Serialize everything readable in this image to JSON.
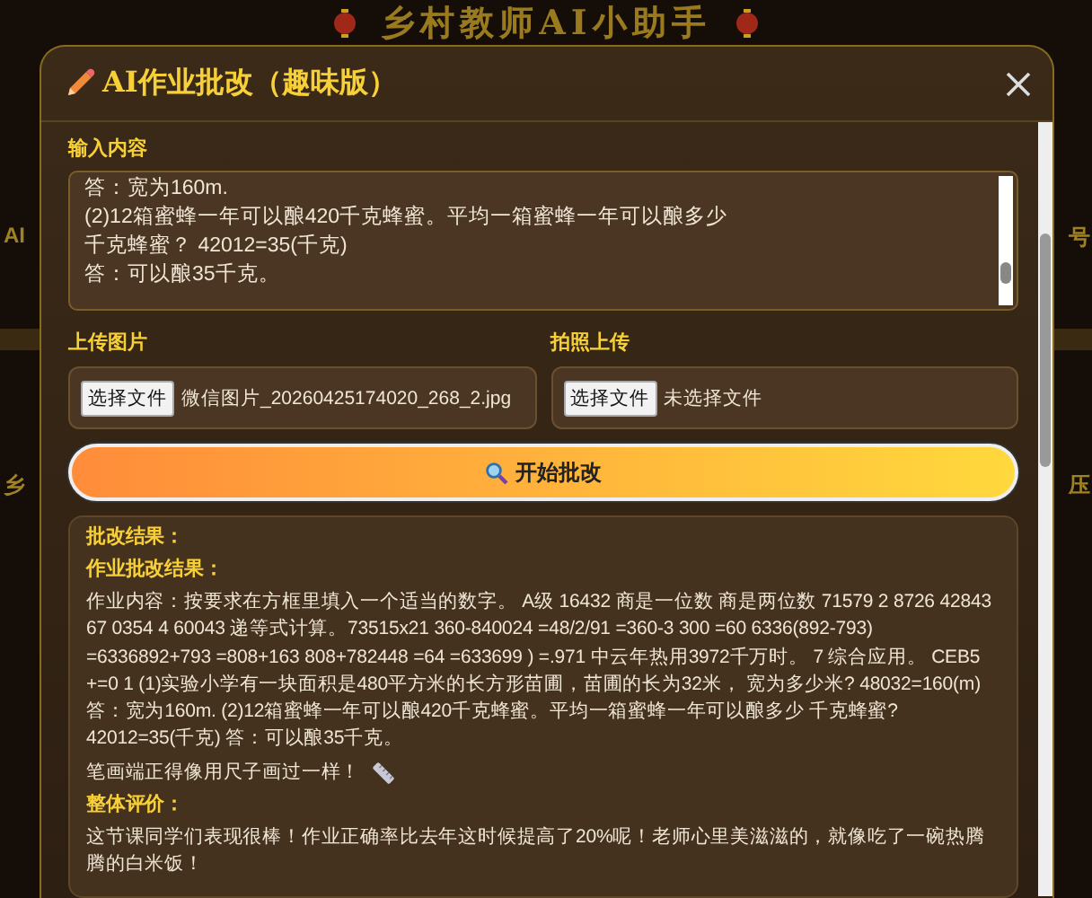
{
  "background": {
    "title": "乡村教师AI小助手",
    "left_labels": [
      "AI",
      "乡"
    ],
    "right_labels": [
      "号",
      "压"
    ]
  },
  "modal": {
    "title": "AI作业批改（趣味版）",
    "input": {
      "label": "输入内容",
      "lines": [
        "答：宽为160m.",
        "(2)12箱蜜蜂一年可以酿420千克蜂蜜。平均一箱蜜蜂一年可以酿多少",
        "千克蜂蜜？  42012=35(千克)",
        "答：可以酿35千克。"
      ]
    },
    "uploads": [
      {
        "label": "上传图片",
        "button": "选择文件",
        "file": "微信图片_20260425174020_268_2.jpg"
      },
      {
        "label": "拍照上传",
        "button": "选择文件",
        "file": "未选择文件"
      }
    ],
    "submit": "开始批改",
    "results": [
      {
        "kind": "heading",
        "text": "批改结果："
      },
      {
        "kind": "heading",
        "text": "作业批改结果："
      },
      {
        "kind": "text",
        "text": "作业内容：按要求在方框里填入一个适当的数字。 A级 16432 商是一位数 商是两位数 71579 2 8726 42843 67 0354 4 60043 递等式计算。73515x21 360-840024 =48/2/91 =360-3 300 =60 6336(892-793) =6336892+793 =808+163 808+782448 =64 =633699 ) =.971 中云年热用3972千万时。 7 综合应用。 CEB5 +=0 1 (1)实验小学有一块面积是480平方米的长方形苗圃，苗圃的长为32米， 宽为多少米? 48032=160(m) 答：宽为160m. (2)12箱蜜蜂一年可以酿420千克蜂蜜。平均一箱蜜蜂一年可以酿多少 千克蜂蜜? 42012=35(千克) 答：可以酿35千克。"
      },
      {
        "kind": "remark",
        "text": "笔画端正得像用尺子画过一样！"
      },
      {
        "kind": "heading",
        "text": "整体评价："
      },
      {
        "kind": "text",
        "text": "这节课同学们表现很棒！作业正确率比去年这时候提高了20%呢！老师心里美滋滋的，就像吃了一碗热腾腾的白米饭！"
      }
    ]
  }
}
